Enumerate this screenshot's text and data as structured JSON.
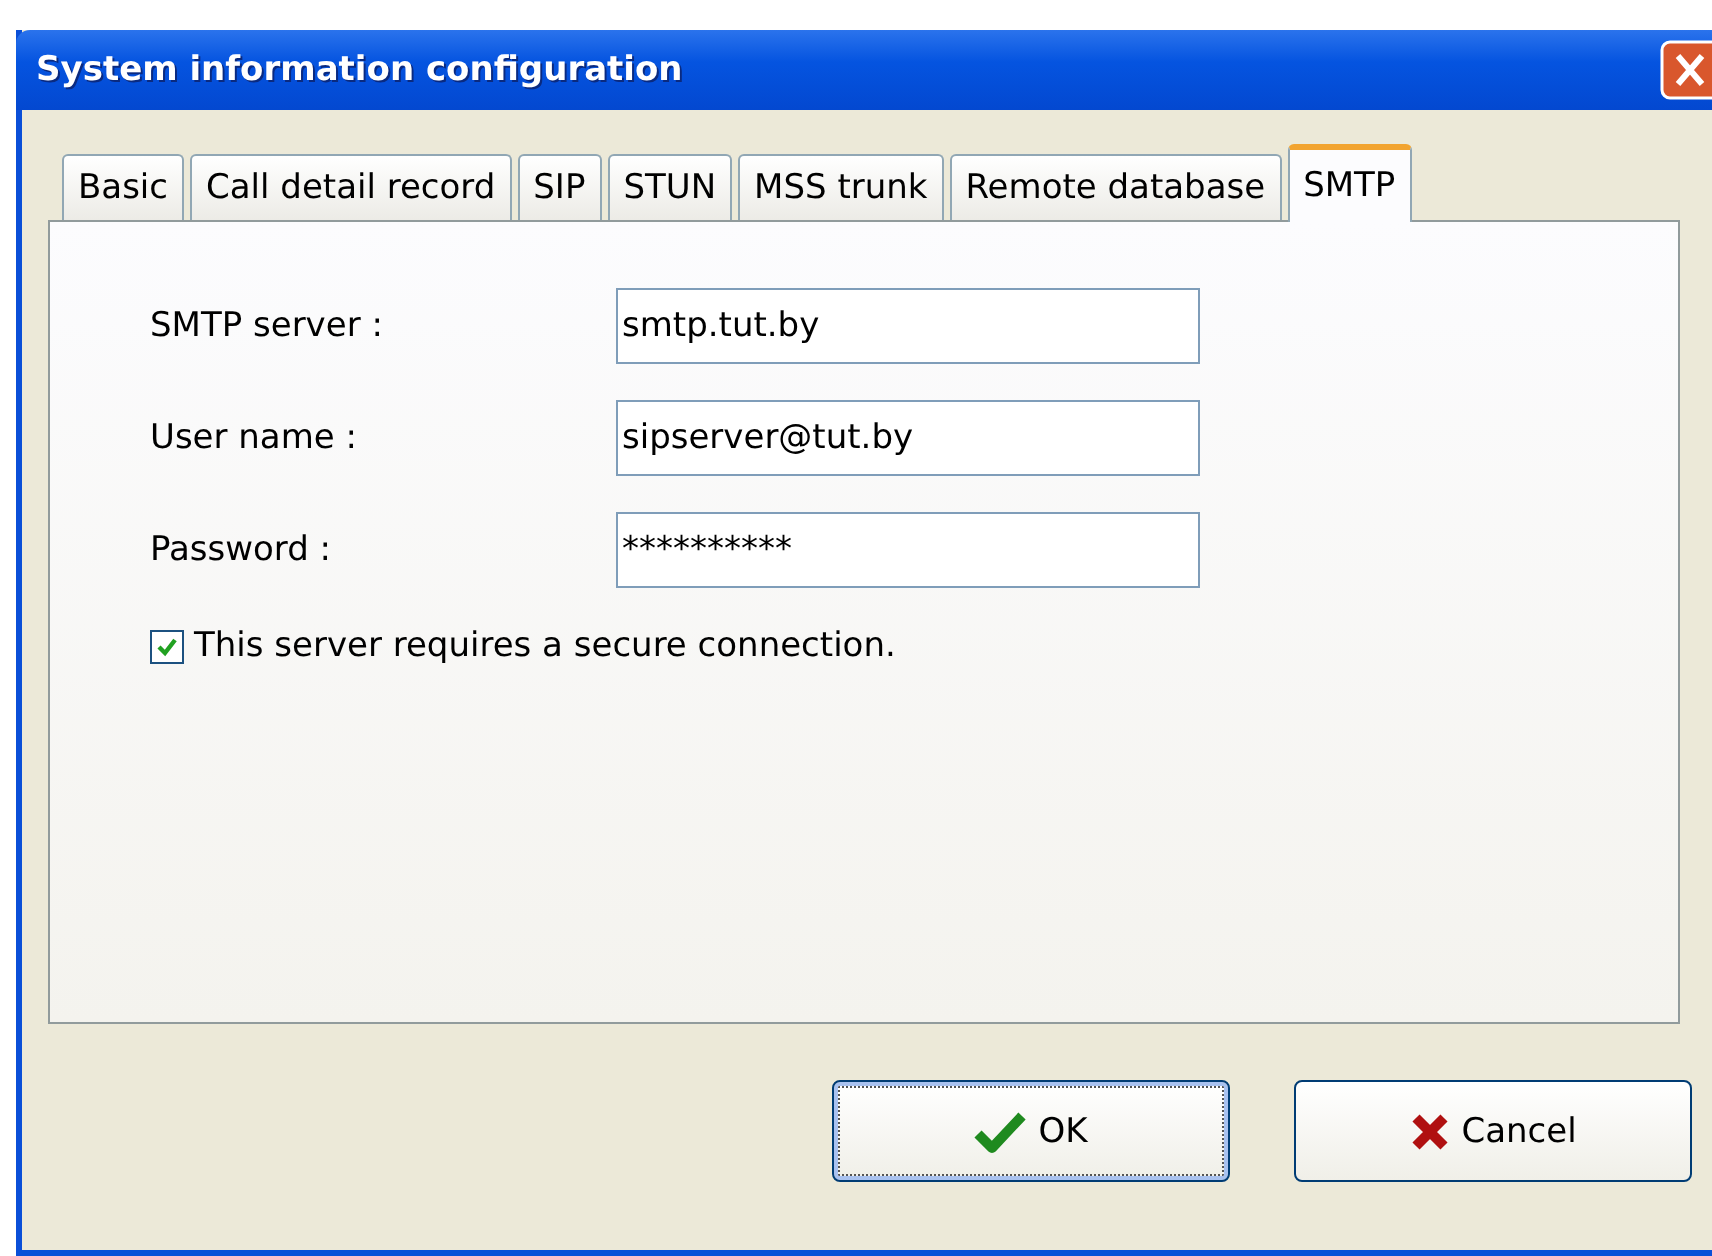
{
  "window": {
    "title": "System information configuration"
  },
  "tabs": [
    {
      "label": "Basic",
      "selected": false
    },
    {
      "label": "Call detail record",
      "selected": false
    },
    {
      "label": "SIP",
      "selected": false
    },
    {
      "label": "STUN",
      "selected": false
    },
    {
      "label": "MSS trunk",
      "selected": false
    },
    {
      "label": "Remote database",
      "selected": false
    },
    {
      "label": "SMTP",
      "selected": true
    }
  ],
  "fields": [
    {
      "label": "SMTP server :",
      "value": "smtp.tut.by"
    },
    {
      "label": "User name :",
      "value": "sipserver@tut.by"
    },
    {
      "label": "Password :",
      "value": "**********"
    }
  ],
  "secure_connection": {
    "label": "This server requires a secure connection.",
    "checked": true
  },
  "buttons": [
    {
      "kind": "ok",
      "label": "OK",
      "focused": true
    },
    {
      "kind": "cancel",
      "label": "Cancel",
      "focused": false
    }
  ]
}
